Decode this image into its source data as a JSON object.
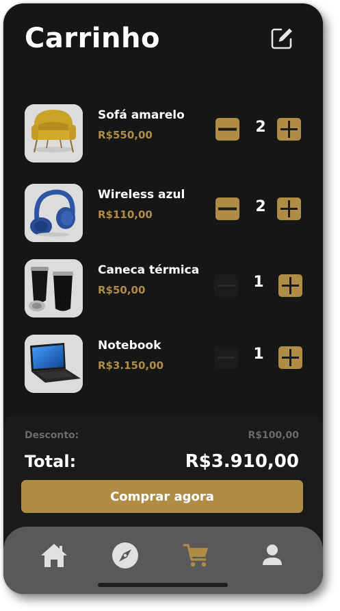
{
  "header": {
    "title": "Carrinho",
    "edit_icon": "edit-icon"
  },
  "cart": {
    "items": [
      {
        "name": "Sofá amarelo",
        "price": "R$550,00",
        "quantity": "2",
        "image": "yellow-armchair"
      },
      {
        "name": "Wireless azul",
        "price": "R$110,00",
        "quantity": "2",
        "image": "blue-headphones"
      },
      {
        "name": "Caneca térmica",
        "price": "R$50,00",
        "quantity": "1",
        "image": "thermal-mugs"
      },
      {
        "name": "Notebook",
        "price": "R$3.150,00",
        "quantity": "1",
        "image": "laptop"
      }
    ]
  },
  "summary": {
    "discount_label": "Desconto:",
    "discount_value": "R$100,00",
    "total_label": "Total:",
    "total_value": "R$3.910,00",
    "buy_label": "Comprar agora"
  },
  "nav": {
    "items": [
      {
        "icon": "home-icon",
        "active": false
      },
      {
        "icon": "compass-icon",
        "active": false
      },
      {
        "icon": "cart-icon",
        "active": true
      },
      {
        "icon": "user-icon",
        "active": false
      }
    ]
  },
  "colors": {
    "background": "#161616",
    "accent": "#b08d47",
    "navbar": "#595959",
    "muted_text": "#6a6a6a",
    "disabled_button": "#1c1c1c"
  }
}
